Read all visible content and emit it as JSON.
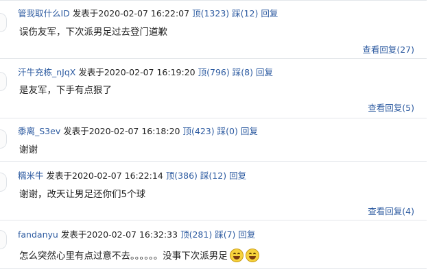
{
  "comments": [
    {
      "username": "管我取什么ID",
      "posted_label": "发表于",
      "timestamp": "2020-02-07 16:22:07",
      "up_label": "顶",
      "up_count": "(1323)",
      "down_label": "踩",
      "down_count": "(12)",
      "reply_label": "回复",
      "text": "误伤友军，下次派男足过去登门道歉",
      "view_replies": "查看回复(27)"
    },
    {
      "username": "汗牛充栋_nJqX",
      "posted_label": "发表于",
      "timestamp": "2020-02-07 16:19:20",
      "up_label": "顶",
      "up_count": "(796)",
      "down_label": "踩",
      "down_count": "(8)",
      "reply_label": "回复",
      "text": "是友军，下手有点狠了",
      "view_replies": "查看回复(5)"
    },
    {
      "username": "黍离_S3ev",
      "posted_label": "发表于",
      "timestamp": "2020-02-07 16:18:20",
      "up_label": "顶",
      "up_count": "(423)",
      "down_label": "踩",
      "down_count": "(0)",
      "reply_label": "回复",
      "text": "谢谢"
    },
    {
      "username": "糯米牛",
      "posted_label": "发表于",
      "timestamp": "2020-02-07 16:22:14",
      "up_label": "顶",
      "up_count": "(386)",
      "down_label": "踩",
      "down_count": "(12)",
      "reply_label": "回复",
      "text": "谢谢，改天让男足还你们5个球",
      "view_replies": "查看回复(4)"
    },
    {
      "username": "fandanyu",
      "posted_label": "发表于",
      "timestamp": "2020-02-07 16:32:33",
      "up_label": "顶",
      "up_count": "(281)",
      "down_label": "踩",
      "down_count": "(7)",
      "reply_label": "回复",
      "text": "怎么突然心里有点过意不去。。。。。。没事下次派男足",
      "emoji_icon": "grinning-sweat-emoji"
    }
  ]
}
